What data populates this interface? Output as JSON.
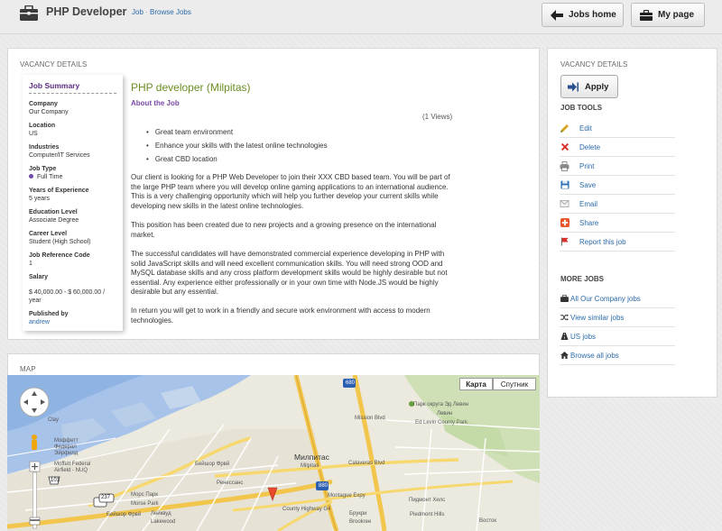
{
  "header": {
    "app_title": "PHP Developer",
    "breadcrumb": [
      {
        "label": "Job"
      },
      {
        "label": "Browse Jobs"
      }
    ],
    "jobs_home_label": "Jobs home",
    "my_page_label": "My page"
  },
  "vacancy": {
    "section_title": "VACANCY DETAILS",
    "summary_title": "Job Summary",
    "fields": {
      "company": {
        "label": "Company",
        "value": "Our Company"
      },
      "location": {
        "label": "Location",
        "value": "US"
      },
      "industries": {
        "label": "Industries",
        "value": "Computer/IT Services"
      },
      "job_type": {
        "label": "Job Type",
        "value": "Full Time"
      },
      "experience": {
        "label": "Years of Experience",
        "value": "5 years"
      },
      "education": {
        "label": "Education Level",
        "value": "Associate Degree"
      },
      "career": {
        "label": "Career Level",
        "value": "Student (High School)"
      },
      "reference": {
        "label": "Job Reference Code",
        "value": "1"
      },
      "salary": {
        "label": "Salary",
        "value": "$ 40,000.00 - $ 60,000.00 / year"
      },
      "published": {
        "label": "Published by",
        "value": "andrew"
      }
    },
    "job_title": "PHP developer (Milpitas)",
    "about_label": "About the Job",
    "views": "(1 Views)",
    "bullets": [
      "Great team environment",
      "Enhance your skills with the latest online technologies",
      "Great CBD location"
    ],
    "paragraphs": [
      "Our client is looking for a PHP Web Developer to join their XXX CBD based team. You will be part of the large PHP team where you will develop online gaming applications to an international audience. This is a very challenging opportunity which will help you further develop your current skills while developing new skills in the latest online technologies.",
      "This position has been created due to new projects and a growing presence on the international market.",
      "The successful candidates will have demonstrated commercial experience developing in PHP with solid JavaScript skills and will need excellent communication skills. You will need strong OOD and MySQL database skills and any cross platform development skills would be highly desirable but not essential. Any experience either professionally or in your own time with Node.JS would be highly desirable but any essential.",
      "In return you will get to work in a friendly and secure work environment with access to modern technologies."
    ]
  },
  "sidebar": {
    "section_title": "VACANCY DETAILS",
    "apply_label": "Apply",
    "tools_title": "JOB TOOLS",
    "tools": [
      {
        "label": "Edit",
        "icon": "pencil-icon"
      },
      {
        "label": "Delete",
        "icon": "delete-x-icon"
      },
      {
        "label": "Print",
        "icon": "printer-icon"
      },
      {
        "label": "Save",
        "icon": "floppy-icon"
      },
      {
        "label": "Email",
        "icon": "envelope-icon"
      },
      {
        "label": "Share",
        "icon": "plus-icon"
      },
      {
        "label": "Report this job",
        "icon": "flag-icon"
      }
    ],
    "more_title": "MORE JOBS",
    "more": [
      {
        "label": "All Our Company jobs",
        "icon": "briefcase-icon"
      },
      {
        "label": "View similar jobs",
        "icon": "shuffle-icon"
      },
      {
        "label": "US jobs",
        "icon": "road-icon"
      },
      {
        "label": "Browse all jobs",
        "icon": "home-icon"
      }
    ]
  },
  "map": {
    "section_title": "MAP",
    "map_btn": "Карта",
    "satellite_btn": "Спутник",
    "labels": {
      "milpitas": "Милпитас",
      "milpitas_en": "Milpitas",
      "park": "Парк округа Эд Левин",
      "park_en": "Ed Levin County Park",
      "piedmont": "Пидмонт Хилс",
      "piedmont_en": "Piedmont Hills",
      "vostok": "Восток",
      "renaissance": "Ренессанс",
      "morse": "Морс Парк",
      "morse_en": "Morse Park",
      "lakewood": "Лейквуд",
      "lakewood_en": "Lakewood",
      "brukri": "Брукри",
      "brukri_en": "Brookree",
      "moffett": "Моффетт Федерал Эйрфилд",
      "moffett_en": "Moffett Federal Airfield - NUQ",
      "bayshore": "Бейшор Фрвй",
      "bayshore2": "Бейшор Фрвй",
      "i680": "680",
      "i880": "880",
      "r237": "237",
      "r101": "101",
      "montague": "Montague Expy",
      "calaveras": "Calaveras Blvd",
      "county": "County Highway G4",
      "mission": "Mission Blvd",
      "clay": "Clay",
      "zevon": "Левин"
    }
  }
}
